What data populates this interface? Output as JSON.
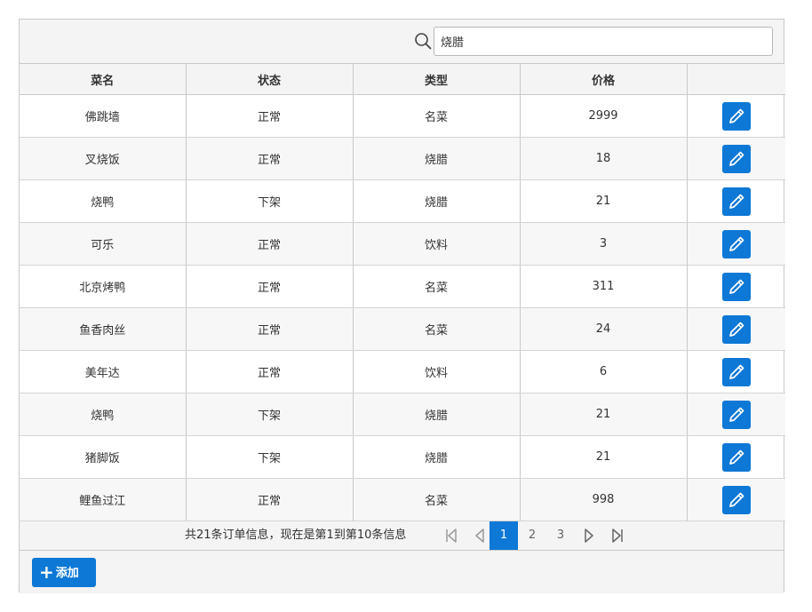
{
  "search": {
    "value": "烧腊"
  },
  "columns": [
    "菜名",
    "状态",
    "类型",
    "价格",
    ""
  ],
  "rows": [
    {
      "name": "佛跳墙",
      "status": "正常",
      "type": "名菜",
      "price": "2999"
    },
    {
      "name": "叉烧饭",
      "status": "正常",
      "type": "烧腊",
      "price": "18"
    },
    {
      "name": "烧鸭",
      "status": "下架",
      "type": "烧腊",
      "price": "21"
    },
    {
      "name": "可乐",
      "status": "正常",
      "type": "饮料",
      "price": "3"
    },
    {
      "name": "北京烤鸭",
      "status": "正常",
      "type": "名菜",
      "price": "311"
    },
    {
      "name": "鱼香肉丝",
      "status": "正常",
      "type": "名菜",
      "price": "24"
    },
    {
      "name": "美年达",
      "status": "正常",
      "type": "饮料",
      "price": "6"
    },
    {
      "name": "烧鸭",
      "status": "下架",
      "type": "烧腊",
      "price": "21"
    },
    {
      "name": "猪脚饭",
      "status": "下架",
      "type": "烧腊",
      "price": "21"
    },
    {
      "name": "鲤鱼过江",
      "status": "正常",
      "type": "名菜",
      "price": "998"
    }
  ],
  "pager": {
    "info": "共21条订单信息，现在是第1到第10条信息",
    "pages": [
      "1",
      "2",
      "3"
    ],
    "current": "1"
  },
  "footer": {
    "add_label": "添加"
  },
  "icons": {
    "search": "search-icon",
    "edit": "pencil-icon",
    "first": "first-page-icon",
    "prev": "prev-page-icon",
    "next": "next-page-icon",
    "last": "last-page-icon",
    "add": "plus-icon"
  },
  "colors": {
    "accent": "#0d78d6",
    "header_bg": "#f4f4f4",
    "alt_row": "#f7f7f7"
  }
}
